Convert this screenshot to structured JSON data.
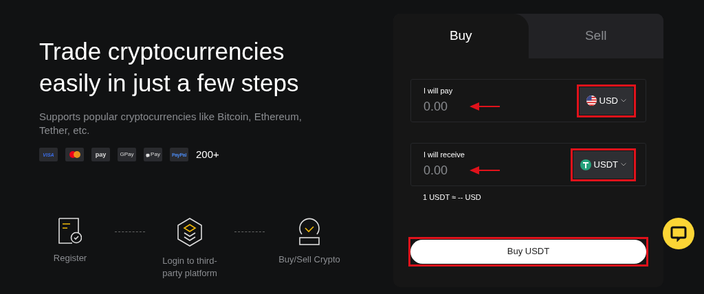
{
  "hero": {
    "title": "Trade cryptocurrencies easily in just a few steps",
    "subtitle": "Supports popular cryptocurrencies like Bitcoin, Ethereum, Tether, etc.",
    "payment_methods": [
      {
        "kind": "visa",
        "label": "VISA"
      },
      {
        "kind": "mastercard"
      },
      {
        "kind": "samsung",
        "label": "pay"
      },
      {
        "kind": "gpay",
        "label": "GPay"
      },
      {
        "kind": "applepay",
        "label": "Pay"
      },
      {
        "kind": "paypal",
        "label": "PayPal"
      }
    ],
    "more_count": "200+"
  },
  "steps": [
    {
      "kind": "register",
      "label": "Register"
    },
    {
      "kind": "login",
      "label": "Login to third-party platform"
    },
    {
      "kind": "trade",
      "label": "Buy/Sell Crypto"
    }
  ],
  "trade_card": {
    "tabs": [
      {
        "label": "Buy",
        "selected": true
      },
      {
        "label": "Sell",
        "selected": false
      }
    ],
    "fields": [
      {
        "label": "I will pay",
        "placeholder": "0.00",
        "currency": "USD",
        "kind": "flag"
      },
      {
        "label": "I will receive",
        "placeholder": "0.00",
        "currency": "USDT",
        "kind": "tether"
      }
    ],
    "rate": "1 USDT ≈ -- USD",
    "submit": "Buy USDT"
  }
}
